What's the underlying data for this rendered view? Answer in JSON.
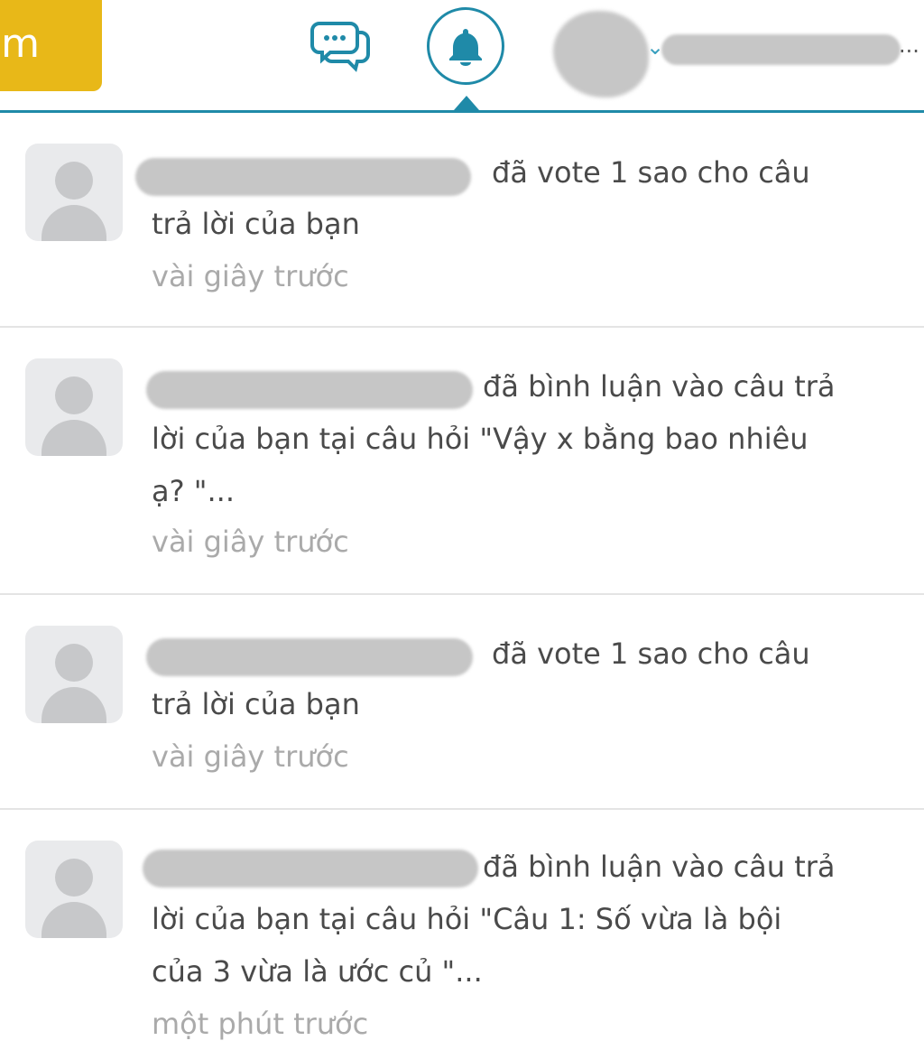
{
  "header": {
    "button_label": "m",
    "messages_icon": "chat-bubbles-icon",
    "notifications_icon": "bell-icon",
    "user_chevron_icon": "chevron-down-icon",
    "user_menu_ellipsis": "..."
  },
  "colors": {
    "accent": "#1f8aa8",
    "button_yellow": "#e8b818",
    "muted_text": "#aaaaaa",
    "body_text": "#4a4a4a"
  },
  "notifications": [
    {
      "line1": "đã vote 1 sao cho câu",
      "line2": "trả lời của bạn",
      "line3": "",
      "time": "vài giây trước"
    },
    {
      "line1": "đã bình luận vào câu trả",
      "line2": "lời của bạn tại câu hỏi \"Vậy x bằng bao nhiêu",
      "line3": "ạ? \"...",
      "time": "vài giây trước"
    },
    {
      "line1": "đã vote 1 sao cho câu",
      "line2": "trả lời của bạn",
      "line3": "",
      "time": "vài giây trước"
    },
    {
      "line1": "đã bình luận vào câu trả",
      "line2": "lời của bạn tại câu hỏi \"Câu 1: Số vừa là bội",
      "line3": "của 3 vừa là ước củ \"...",
      "time": "một phút trước"
    }
  ]
}
